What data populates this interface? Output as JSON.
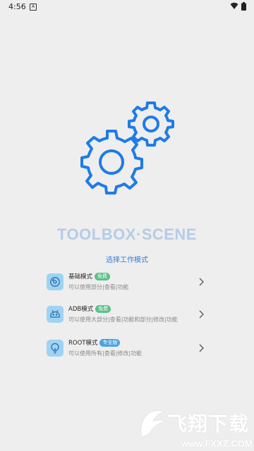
{
  "status_bar": {
    "time": "4:56",
    "notification_glyph": "A"
  },
  "app_title": "TOOLBOX·SCENE",
  "subtitle": "选择工作模式",
  "modes": [
    {
      "name": "基础模式",
      "badge": "免费",
      "desc": "可以使用部分|查看|功能",
      "icon": "disc-icon"
    },
    {
      "name": "ADB模式",
      "badge": "免费",
      "desc": "可以使用大部分|查看|功能和部分|修改|功能",
      "icon": "android-icon"
    },
    {
      "name": "ROOT模式",
      "badge": "专业版",
      "desc": "可以使用所有|查看|修改|功能",
      "icon": "lightbulb-icon"
    }
  ],
  "watermark": {
    "text": "飞翔下载",
    "url": "www.FXXZ.COM"
  },
  "colors": {
    "accent": "#1e7be8",
    "title": "#b6cbe6",
    "free_badge": "#5bc08b",
    "pro_badge": "#4aa3df",
    "icon_bg": "#9ed3f2"
  }
}
